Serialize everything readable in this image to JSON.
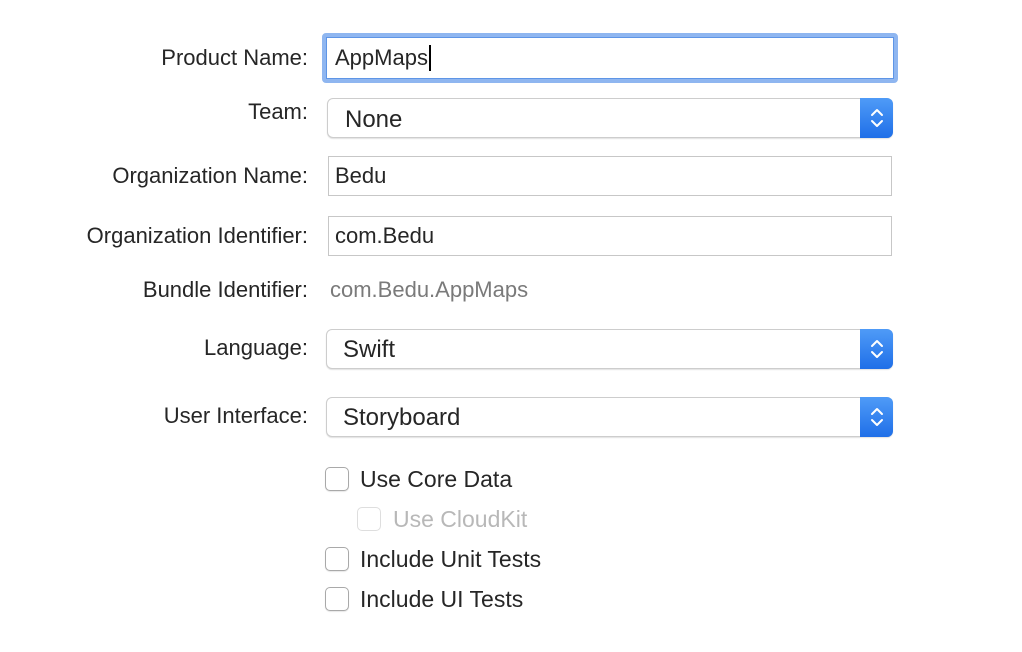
{
  "form": {
    "product_name": {
      "label": "Product Name:",
      "value": "AppMaps"
    },
    "team": {
      "label": "Team:",
      "value": "None"
    },
    "organization_name": {
      "label": "Organization Name:",
      "value": "Bedu"
    },
    "organization_identifier": {
      "label": "Organization Identifier:",
      "value": "com.Bedu"
    },
    "bundle_identifier": {
      "label": "Bundle Identifier:",
      "value": "com.Bedu.AppMaps"
    },
    "language": {
      "label": "Language:",
      "value": "Swift"
    },
    "user_interface": {
      "label": "User Interface:",
      "value": "Storyboard"
    }
  },
  "options": {
    "use_core_data": {
      "label": "Use Core Data",
      "checked": false,
      "enabled": true
    },
    "use_cloudkit": {
      "label": "Use CloudKit",
      "checked": false,
      "enabled": false
    },
    "include_unit_tests": {
      "label": "Include Unit Tests",
      "checked": false,
      "enabled": true
    },
    "include_ui_tests": {
      "label": "Include UI Tests",
      "checked": false,
      "enabled": true
    }
  },
  "colors": {
    "focus_ring": "#8fb6f0",
    "accent": "#1f6fe8",
    "disabled_text": "#b8b8b8",
    "secondary_text": "#7a7a7a"
  },
  "icons": {
    "popup_indicator": "up-down-chevron-icon"
  }
}
